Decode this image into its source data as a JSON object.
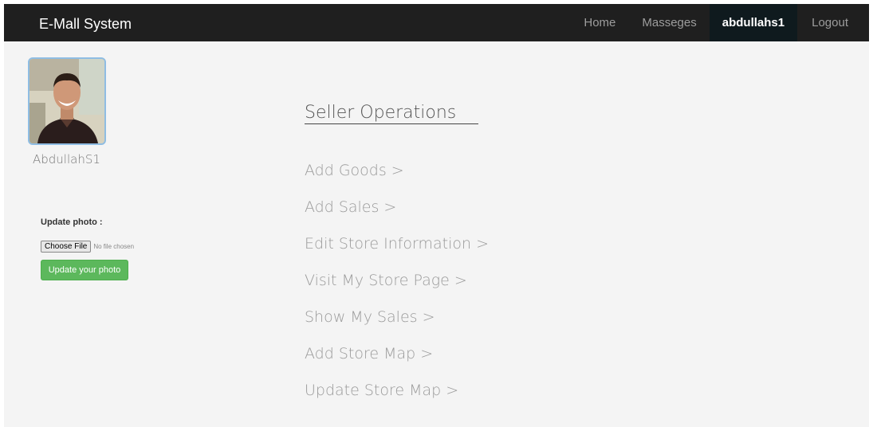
{
  "navbar": {
    "brand": "E-Mall System",
    "items": [
      {
        "label": "Home"
      },
      {
        "label": "Masseges"
      },
      {
        "label": "abdullahs1"
      },
      {
        "label": "Logout"
      }
    ]
  },
  "profile": {
    "username": "AbdullahS1",
    "update_label": "Update photo :",
    "choose_file_label": "Choose File",
    "no_file_text": "No file chosen",
    "update_button_label": "Update your photo"
  },
  "operations": {
    "title": "Seller Operations",
    "items": [
      {
        "label": "Add Goods >"
      },
      {
        "label": "Add Sales >"
      },
      {
        "label": "Edit Store Information >"
      },
      {
        "label": "Visit My Store Page >"
      },
      {
        "label": "Show My Sales >"
      },
      {
        "label": "Add Store Map >"
      },
      {
        "label": "Update Store Map >"
      }
    ]
  },
  "colors": {
    "navbar_bg": "#1f1f1f",
    "active_nav_bg": "#0f1a1e",
    "page_bg": "#f4f4f4",
    "update_button": "#5cb85c",
    "avatar_border": "#8fbde3"
  }
}
